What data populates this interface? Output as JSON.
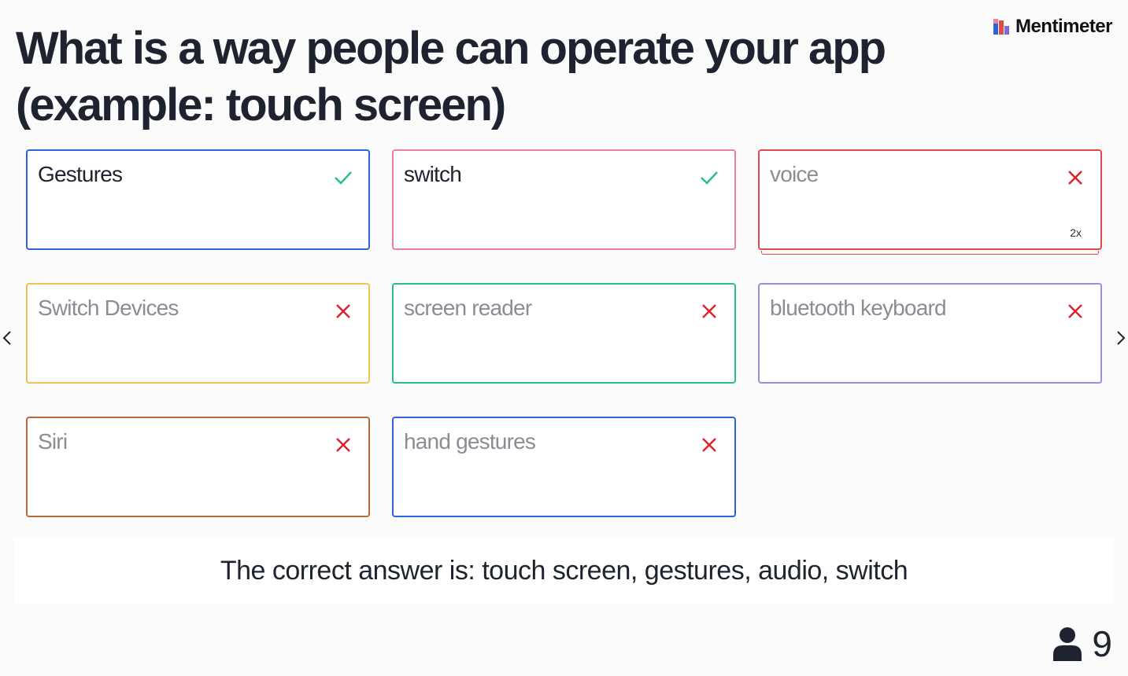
{
  "brand": {
    "name": "Mentimeter"
  },
  "question": {
    "title": "What is a way people can operate your app (example: touch screen)"
  },
  "answers": [
    {
      "label": "Gestures",
      "status": "correct",
      "color": "#2c63d6",
      "count": ""
    },
    {
      "label": "switch",
      "status": "correct",
      "color": "#ec7ea1",
      "count": ""
    },
    {
      "label": "voice",
      "status": "wrong",
      "color": "#e24a4a",
      "count": "2x"
    },
    {
      "label": "Switch Devices",
      "status": "wrong",
      "color": "#f2c14e",
      "count": ""
    },
    {
      "label": "screen reader",
      "status": "wrong",
      "color": "#2bbf8f",
      "count": ""
    },
    {
      "label": "bluetooth keyboard",
      "status": "wrong",
      "color": "#9391d9",
      "count": ""
    },
    {
      "label": "Siri",
      "status": "wrong",
      "color": "#b8693a",
      "count": ""
    },
    {
      "label": "hand gestures",
      "status": "wrong",
      "color": "#2c63d6",
      "count": ""
    }
  ],
  "status_colors": {
    "correct": "#2bbf8f",
    "wrong": "#e0222e"
  },
  "icons": {
    "correct": "check-icon",
    "wrong": "cross-icon"
  },
  "correct_answer": {
    "text": "The correct answer is: touch screen, gestures, audio, switch"
  },
  "participants": {
    "count": "9",
    "icon": "person-icon"
  }
}
